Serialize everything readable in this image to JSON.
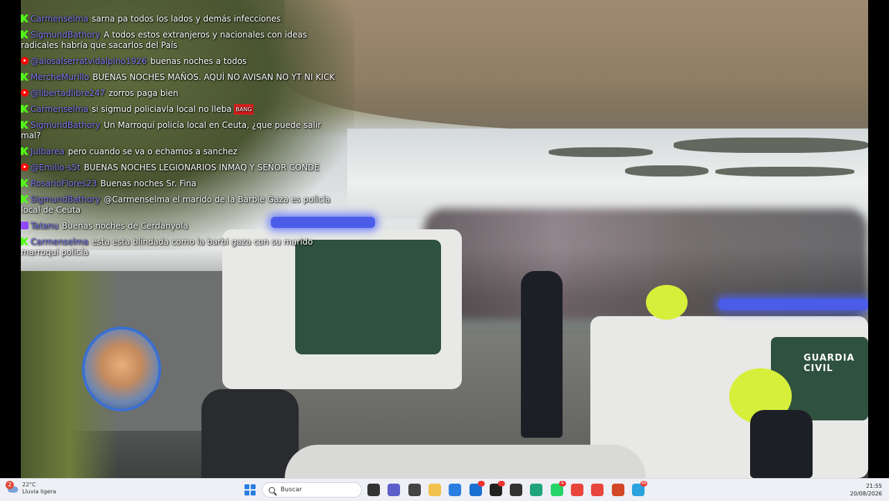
{
  "chat": [
    {
      "platform": "kick",
      "user": "Carmenselma",
      "text": "sarna pa todos los lados y demás infecciones"
    },
    {
      "platform": "kick",
      "user": "SigmundBathory",
      "text": "A todos estos extranjeros y nacionales con ideas radicales habría que sacarlos del País"
    },
    {
      "platform": "youtube",
      "user": "@aiosalserratvidalpino1926",
      "text": "buenas noches a todos"
    },
    {
      "platform": "kick",
      "user": "MercheMurillo",
      "text": "BUENAS NOCHES MAÑOS. AQUÍ NO AVISAN NO YT NI KICK"
    },
    {
      "platform": "youtube",
      "user": "@libertadlibre247",
      "text": "zorros paga bien"
    },
    {
      "platform": "kick",
      "user": "Carmenselma",
      "text": "si sigmud policiavla local no lleba",
      "emote": "BANG"
    },
    {
      "platform": "kick",
      "user": "SigmundBathory",
      "text": "Un Marroquí policía local en Ceuta, ¿que puede salir mal?"
    },
    {
      "platform": "kick",
      "user": "Julbarea",
      "text": "pero cuando se va o echamos a sanchez"
    },
    {
      "platform": "youtube",
      "user": "@Emilio-s5t",
      "text": "BUENAS NOCHES LEGIONARIOS INMAQ Y SEÑOR CONDE"
    },
    {
      "platform": "kick",
      "user": "RosarioFlores23",
      "text": "Buenas noches Sr. Fina"
    },
    {
      "platform": "kick",
      "user": "SigmundBathory",
      "text": "@Carmenselma el marido de la Barbie Gaza es policía local de Ceuta"
    },
    {
      "platform": "twitch",
      "user": "Tatanu",
      "text": "Buenas noches de Cerdanyola"
    },
    {
      "platform": "kick",
      "user": "Carmenselma",
      "text": "esta esta blindada como la barbi gaza con su marido marroquí policía"
    }
  ],
  "video": {
    "vehicle_text": "GUARDIA CIVIL"
  },
  "taskbar": {
    "weather": {
      "temp": "22°C",
      "desc": "Lluvia ligera",
      "alerts": "2"
    },
    "search_placeholder": "Buscar",
    "icons": [
      {
        "name": "task-view-icon",
        "color": "#333333"
      },
      {
        "name": "teams-icon",
        "color": "#5b5fc7"
      },
      {
        "name": "app-icon",
        "color": "#444444"
      },
      {
        "name": "file-explorer-icon",
        "color": "#f2c14e"
      },
      {
        "name": "store-icon",
        "color": "#2a7de1"
      },
      {
        "name": "outlook-icon",
        "color": "#1a6fd1",
        "badge": ""
      },
      {
        "name": "obs-icon",
        "color": "#222222",
        "badge": ""
      },
      {
        "name": "unity-icon",
        "color": "#333333"
      },
      {
        "name": "edge-icon",
        "color": "#1fa37a"
      },
      {
        "name": "whatsapp-icon",
        "color": "#25d366",
        "badge": "4"
      },
      {
        "name": "chrome-icon",
        "color": "#e8453c"
      },
      {
        "name": "chrome-profile-icon",
        "color": "#e8453c"
      },
      {
        "name": "powerpoint-icon",
        "color": "#d24726"
      },
      {
        "name": "telegram-icon",
        "color": "#2aa3df",
        "badge": "99"
      }
    ],
    "time": "21:55",
    "date": "20/08/2026"
  }
}
